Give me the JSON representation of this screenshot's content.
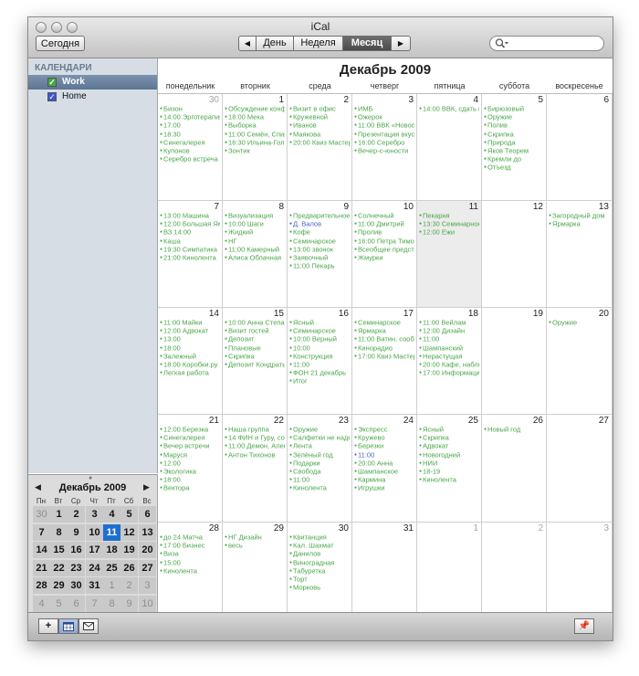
{
  "window": {
    "title": "iCal"
  },
  "toolbar": {
    "today_label": "Сегодня",
    "view_labels": {
      "day": "День",
      "week": "Неделя",
      "month": "Месяц"
    },
    "active_view": "month",
    "prev_glyph": "◀",
    "next_glyph": "▶"
  },
  "search": {
    "value": "",
    "placeholder": ""
  },
  "sidebar": {
    "header": "КАЛЕНДАРИ",
    "calendars": [
      {
        "name": "Work",
        "checked": true,
        "selected": true,
        "color": "#3faa3f"
      },
      {
        "name": "Home",
        "checked": true,
        "selected": false,
        "color": "#3b57d6"
      }
    ]
  },
  "mini_calendar": {
    "title": "Декабрь 2009",
    "prev_glyph": "◀",
    "next_glyph": "▶",
    "weekdays": [
      "Пн",
      "Вт",
      "Ср",
      "Чт",
      "Пт",
      "Сб",
      "Вс"
    ],
    "days": [
      "30",
      "1",
      "2",
      "3",
      "4",
      "5",
      "6",
      "7",
      "8",
      "9",
      "10",
      "11",
      "12",
      "13",
      "14",
      "15",
      "16",
      "17",
      "18",
      "19",
      "20",
      "21",
      "22",
      "23",
      "24",
      "25",
      "26",
      "27",
      "28",
      "29",
      "30",
      "31",
      "1",
      "2",
      "3",
      "4",
      "5",
      "6",
      "7",
      "8",
      "9",
      "10"
    ],
    "first_index": 1,
    "last_index": 31,
    "today_index": 11
  },
  "main": {
    "month_title": "Декабрь 2009",
    "weekdays": [
      "понедельник",
      "вторник",
      "среда",
      "четверг",
      "пятница",
      "суббота",
      "воскресенье"
    ],
    "today_index": 11,
    "weeks": [
      [
        {
          "day": "30",
          "other": true,
          "events": [
            "Бизон",
            "14:00 Эрготерапия",
            "17:00",
            "18:30",
            "Синегалерея",
            "Купонов",
            "Серебро встреча"
          ]
        },
        {
          "day": "1",
          "other": false,
          "events": [
            "Обсуждение конференции",
            "18:00 Мека",
            "Выборка",
            "11:00 Семён, Спиридон",
            "16:30 Ильина-Гольм",
            "Зонтик"
          ]
        },
        {
          "day": "2",
          "other": false,
          "events": [
            "Визит в офис",
            "Кружевной",
            "Иванов",
            "Маякова",
            "20:00 Квиз Мастер"
          ]
        },
        {
          "day": "3",
          "other": false,
          "events": [
            "ИМБ",
            "Ожерок",
            "11:00 ВВК «Новость»",
            "Презентация вкуса",
            "16:00 Серебро",
            "Вечер-с-юности"
          ]
        },
        {
          "day": "4",
          "other": false,
          "events": [
            "14:00 ВВК, сдать по неделям"
          ]
        },
        {
          "day": "5",
          "other": false,
          "events": [
            "Бирюзовый",
            "Оружие",
            "Полив",
            "Скрипка",
            "Природа",
            "Яков Теорем",
            "Кремли до",
            "Отъезд"
          ]
        },
        {
          "day": "6",
          "other": false,
          "events": []
        }
      ],
      [
        {
          "day": "7",
          "other": false,
          "events": [
            "13:00 Машина",
            "12:00 Большая Ямская, 21",
            "ВЗ 14:00",
            "Каша",
            "19:30 Симпатика",
            "21:00 Кинолента"
          ]
        },
        {
          "day": "8",
          "other": false,
          "events": [
            "Визуализация",
            "10:00 Шаги",
            "Жидкий",
            "НГ",
            "11:00 Камерный",
            "Алиса Облачная"
          ]
        },
        {
          "day": "9",
          "other": false,
          "events": [
            "Предварительное собрание",
            "Д. Валов",
            "Кофе",
            "Семинарское",
            "13:00 звонок",
            "Заявочный",
            "11:00 Пекарь"
          ]
        },
        {
          "day": "10",
          "other": false,
          "events": [
            "Солнечный",
            "11:00 Дмитрий",
            "Пролив",
            "16:00 Петра Тимофеева",
            "Всеобщее представление",
            "Жмурки"
          ]
        },
        {
          "day": "11",
          "other": false,
          "events": [
            "Пекарня",
            "13:30 Семинарное",
            "12:00 Ежи"
          ]
        },
        {
          "day": "12",
          "other": false,
          "events": []
        },
        {
          "day": "13",
          "other": false,
          "events": [
            "Загородный дом",
            "Ярмарка"
          ]
        }
      ],
      [
        {
          "day": "14",
          "other": false,
          "events": [
            "11:00 Майки",
            "12:00 Адвокат",
            "13:00",
            "18:00",
            "Залежный",
            "18:00 Коробки.ру",
            "Легкая работа"
          ]
        },
        {
          "day": "15",
          "other": false,
          "events": [
            "10:00 Анна Степанова",
            "Визит гостей",
            "Депозит",
            "Плановые",
            "Скрипка",
            "Депозит Кондратьева"
          ]
        },
        {
          "day": "16",
          "other": false,
          "events": [
            "Ясный",
            "Семинарское",
            "10:00 Верный",
            "10:00",
            "Конструкция",
            "11:00",
            "ФОН 21 декабрь",
            "Итог"
          ]
        },
        {
          "day": "17",
          "other": false,
          "events": [
            "Семинарское",
            "Ярмарка",
            "11:00 Ватин, сообщения",
            "Кинорадио",
            "17:00 Квиз Мастер"
          ]
        },
        {
          "day": "18",
          "other": false,
          "events": [
            "11:00 Вейлам",
            "12:00 Дизайн",
            "11:00",
            "Шампанский",
            "Нерастущая",
            "20:00 Кафе, наблюдение",
            "17:00 Информация"
          ]
        },
        {
          "day": "19",
          "other": false,
          "events": []
        },
        {
          "day": "20",
          "other": false,
          "events": [
            "Оружие"
          ]
        }
      ],
      [
        {
          "day": "21",
          "other": false,
          "events": [
            "12:00 Березка",
            "Синегалерея",
            "Вечер встречи",
            "Маруся",
            "12:00",
            "Экологика",
            "18:00",
            "Вектора"
          ]
        },
        {
          "day": "22",
          "other": false,
          "events": [
            "Наша группа",
            "14 ФИН и Гуру, соглас. план года",
            "11:00 Демон, Александра",
            "Антон Тихонов"
          ]
        },
        {
          "day": "23",
          "other": false,
          "events": [
            "Оружие",
            "Салфетки не надо",
            "Лента",
            "Зелёный год",
            "Подарки",
            "Свобода",
            "11:00",
            "Кинолента"
          ]
        },
        {
          "day": "24",
          "other": false,
          "events": [
            "Экспресс",
            "Кружево",
            "Березки",
            "11:00",
            "20:00 Анна",
            "Шампанское",
            "Кармина",
            "Игрушки"
          ]
        },
        {
          "day": "25",
          "other": false,
          "events": [
            "Ясный",
            "Скрипка",
            "Адвокат",
            "Новогодний",
            "НИИ",
            "18-19",
            "Кинолента"
          ]
        },
        {
          "day": "26",
          "other": false,
          "events": [
            "Новый год"
          ]
        },
        {
          "day": "27",
          "other": false,
          "events": []
        }
      ],
      [
        {
          "day": "28",
          "other": false,
          "events": [
            "до 24 Матча",
            "17:00 Бизнес",
            "Виза",
            "15:00",
            "Кинолента"
          ]
        },
        {
          "day": "29",
          "other": false,
          "events": [
            "НГ Дизайн",
            "весь"
          ]
        },
        {
          "day": "30",
          "other": false,
          "events": [
            "Квитанция",
            "Кал. Шахмат",
            "Данилов",
            "Виноградная",
            "Табуретка",
            "Торт",
            "Морковь"
          ]
        },
        {
          "day": "31",
          "other": false,
          "events": []
        },
        {
          "day": "1",
          "other": true,
          "events": []
        },
        {
          "day": "2",
          "other": true,
          "events": []
        },
        {
          "day": "3",
          "other": true,
          "events": []
        }
      ]
    ]
  },
  "bottom_bar": {
    "add_glyph": "+",
    "pin_glyph": "📌"
  }
}
